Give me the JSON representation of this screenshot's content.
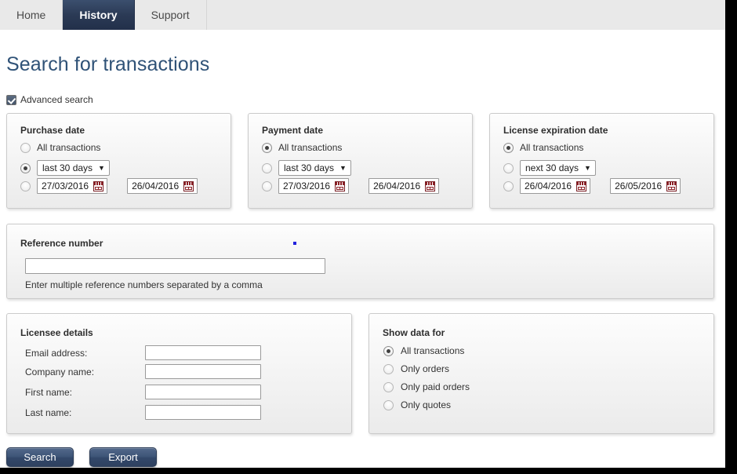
{
  "tabs": [
    {
      "label": "Home",
      "active": false
    },
    {
      "label": "History",
      "active": true
    },
    {
      "label": "Support",
      "active": false
    }
  ],
  "header": {
    "title": "Search for transactions"
  },
  "advanced_search": {
    "label": "Advanced search",
    "checked": true
  },
  "date_panels": [
    {
      "legend": "Purchase date",
      "all_label": "All transactions",
      "all_selected": false,
      "preset": "last 30 days",
      "preset_selected": true,
      "range_selected": false,
      "date_from": "27/03/2016",
      "date_to": "26/04/2016"
    },
    {
      "legend": "Payment date",
      "all_label": "All transactions",
      "all_selected": true,
      "preset": "last 30 days",
      "preset_selected": false,
      "range_selected": false,
      "date_from": "27/03/2016",
      "date_to": "26/04/2016"
    },
    {
      "legend": "License expiration date",
      "all_label": "All transactions",
      "all_selected": true,
      "preset": "next 30 days",
      "preset_selected": false,
      "range_selected": false,
      "date_from": "26/04/2016",
      "date_to": "26/05/2016"
    }
  ],
  "reference": {
    "legend": "Reference number",
    "value": "",
    "placeholder": "",
    "hint": "Enter multiple reference numbers separated by a comma"
  },
  "licensee": {
    "legend": "Licensee details",
    "fields": [
      {
        "label": "Email address:",
        "value": "",
        "name": "email-field"
      },
      {
        "label": "Company name:",
        "value": "",
        "name": "company-field"
      },
      {
        "label": "First name:",
        "value": "",
        "name": "first-name-field"
      },
      {
        "label": "Last name:",
        "value": "",
        "name": "last-name-field"
      }
    ]
  },
  "show_data_for": {
    "legend": "Show data for",
    "options": [
      {
        "label": "All transactions",
        "selected": true
      },
      {
        "label": "Only orders",
        "selected": false
      },
      {
        "label": "Only paid orders",
        "selected": false
      },
      {
        "label": "Only quotes",
        "selected": false
      }
    ]
  },
  "actions": {
    "search_label": "Search",
    "export_label": "Export"
  },
  "colors": {
    "active_tab": "#2b3a55",
    "title": "#2f5277",
    "button": "#3f5678",
    "calendar_icon": "#8c2026",
    "marker_dot": "#2222dd"
  }
}
